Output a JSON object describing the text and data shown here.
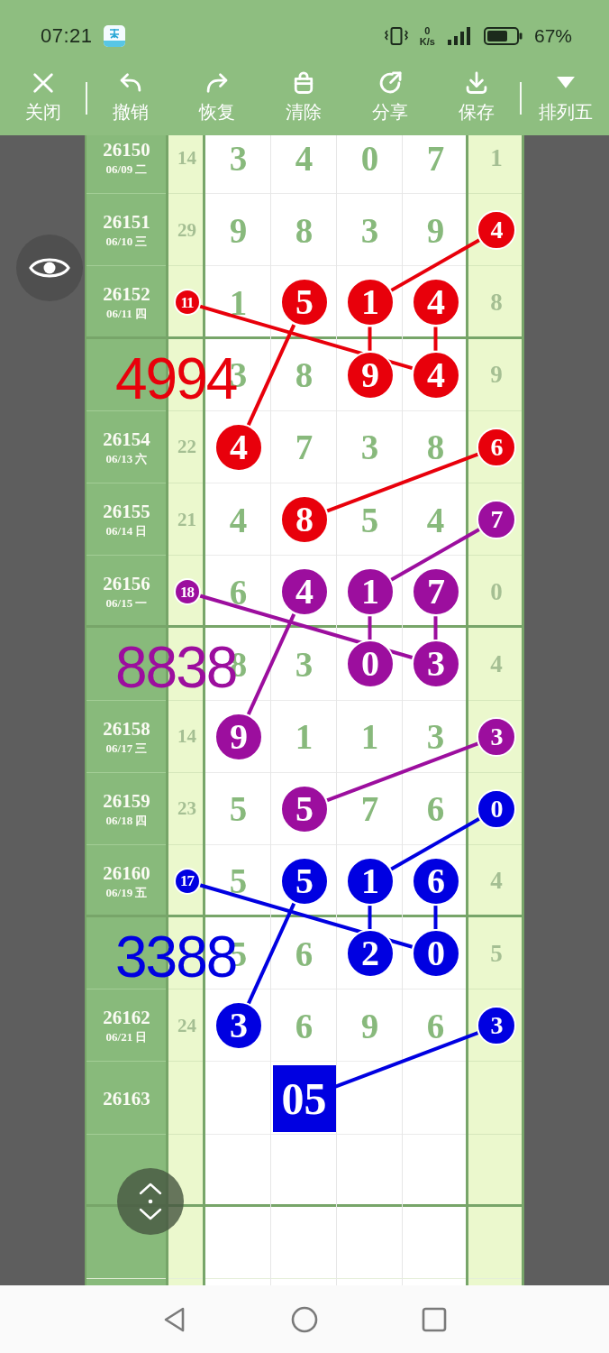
{
  "status_bar": {
    "time": "07:21",
    "net_speed": {
      "value": "0",
      "unit": "K/s"
    },
    "battery": "67%"
  },
  "toolbar": {
    "left": [
      {
        "kind": "close",
        "label": "关闭"
      }
    ],
    "actions": [
      {
        "kind": "undo",
        "label": "撤销"
      },
      {
        "kind": "redo",
        "label": "恢复"
      },
      {
        "kind": "clear",
        "label": "清除"
      },
      {
        "kind": "share",
        "label": "分享"
      },
      {
        "kind": "save",
        "label": "保存"
      }
    ],
    "right": [
      {
        "kind": "menu",
        "label": "排列五"
      }
    ]
  },
  "grid": {
    "rows": [
      {
        "period": "26150",
        "date": "06/09 二",
        "cells": [
          {
            "value": "14",
            "marked": false
          },
          {
            "value": "3",
            "marked": false
          },
          {
            "value": "4",
            "marked": false
          },
          {
            "value": "0",
            "marked": false
          },
          {
            "value": "7",
            "marked": false
          },
          {
            "value": "1",
            "marked": false
          }
        ]
      },
      {
        "period": "26151",
        "date": "06/10 三",
        "cells": [
          {
            "value": "29",
            "marked": false
          },
          {
            "value": "9",
            "marked": false
          },
          {
            "value": "8",
            "marked": false
          },
          {
            "value": "3",
            "marked": false
          },
          {
            "value": "9",
            "marked": false
          },
          {
            "value": "4",
            "marked": true,
            "kind": "circle",
            "color": "#e8000b"
          }
        ]
      },
      {
        "period": "26152",
        "date": "06/11 四",
        "cells": [
          {
            "value": "11",
            "marked": true,
            "kind": "circle",
            "color": "#e8000b"
          },
          {
            "value": "1",
            "marked": false
          },
          {
            "value": "5",
            "marked": true,
            "kind": "circle",
            "color": "#e8000b"
          },
          {
            "value": "1",
            "marked": true,
            "kind": "circle",
            "color": "#e8000b"
          },
          {
            "value": "4",
            "marked": true,
            "kind": "circle",
            "color": "#e8000b"
          },
          {
            "value": "8",
            "marked": false
          }
        ]
      },
      {
        "note": {
          "text": "4994",
          "color": "#e8000b"
        },
        "cells": [
          {
            "marked": false
          },
          {
            "value": "3",
            "marked": false
          },
          {
            "value": "8",
            "marked": false
          },
          {
            "value": "9",
            "marked": true,
            "kind": "circle",
            "color": "#e8000b"
          },
          {
            "value": "4",
            "marked": true,
            "kind": "circle",
            "color": "#e8000b"
          },
          {
            "value": "9",
            "marked": false
          }
        ]
      },
      {
        "period": "26154",
        "date": "06/13 六",
        "cells": [
          {
            "value": "22",
            "marked": false
          },
          {
            "value": "4",
            "marked": true,
            "kind": "circle",
            "color": "#e8000b"
          },
          {
            "value": "7",
            "marked": false
          },
          {
            "value": "3",
            "marked": false
          },
          {
            "value": "8",
            "marked": false
          },
          {
            "value": "6",
            "marked": true,
            "kind": "circle",
            "color": "#e8000b"
          }
        ]
      },
      {
        "period": "26155",
        "date": "06/14 日",
        "cells": [
          {
            "value": "21",
            "marked": false
          },
          {
            "value": "4",
            "marked": false
          },
          {
            "value": "8",
            "marked": true,
            "kind": "circle",
            "color": "#e8000b"
          },
          {
            "value": "5",
            "marked": false
          },
          {
            "value": "4",
            "marked": false
          },
          {
            "value": "7",
            "marked": true,
            "kind": "circle",
            "color": "#9c0e9e"
          }
        ]
      },
      {
        "period": "26156",
        "date": "06/15 一",
        "cells": [
          {
            "value": "18",
            "marked": true,
            "kind": "circle",
            "color": "#9c0e9e"
          },
          {
            "value": "6",
            "marked": false
          },
          {
            "value": "4",
            "marked": true,
            "kind": "circle",
            "color": "#9c0e9e"
          },
          {
            "value": "1",
            "marked": true,
            "kind": "circle",
            "color": "#9c0e9e"
          },
          {
            "value": "7",
            "marked": true,
            "kind": "circle",
            "color": "#9c0e9e"
          },
          {
            "value": "0",
            "marked": false
          }
        ]
      },
      {
        "note": {
          "text": "8838",
          "color": "#9c0e9e"
        },
        "cells": [
          {
            "marked": false
          },
          {
            "value": "8",
            "marked": false
          },
          {
            "value": "3",
            "marked": false
          },
          {
            "value": "0",
            "marked": true,
            "kind": "circle",
            "color": "#9c0e9e"
          },
          {
            "value": "3",
            "marked": true,
            "kind": "circle",
            "color": "#9c0e9e"
          },
          {
            "value": "4",
            "marked": false
          }
        ]
      },
      {
        "period": "26158",
        "date": "06/17 三",
        "cells": [
          {
            "value": "14",
            "marked": false
          },
          {
            "value": "9",
            "marked": true,
            "kind": "circle",
            "color": "#9c0e9e"
          },
          {
            "value": "1",
            "marked": false
          },
          {
            "value": "1",
            "marked": false
          },
          {
            "value": "3",
            "marked": false
          },
          {
            "value": "3",
            "marked": true,
            "kind": "circle",
            "color": "#9c0e9e"
          }
        ]
      },
      {
        "period": "26159",
        "date": "06/18 四",
        "cells": [
          {
            "value": "23",
            "marked": false
          },
          {
            "value": "5",
            "marked": false
          },
          {
            "value": "5",
            "marked": true,
            "kind": "circle",
            "color": "#9c0e9e"
          },
          {
            "value": "7",
            "marked": false
          },
          {
            "value": "6",
            "marked": false
          },
          {
            "value": "0",
            "marked": true,
            "kind": "circle",
            "color": "#0000e1"
          }
        ]
      },
      {
        "period": "26160",
        "date": "06/19 五",
        "cells": [
          {
            "value": "17",
            "marked": true,
            "kind": "circle",
            "color": "#0000e1"
          },
          {
            "value": "5",
            "marked": false
          },
          {
            "value": "5",
            "marked": true,
            "kind": "circle",
            "color": "#0000e1"
          },
          {
            "value": "1",
            "marked": true,
            "kind": "circle",
            "color": "#0000e1"
          },
          {
            "value": "6",
            "marked": true,
            "kind": "circle",
            "color": "#0000e1"
          },
          {
            "value": "4",
            "marked": false
          }
        ]
      },
      {
        "note": {
          "text": "3388",
          "color": "#0000e1"
        },
        "cells": [
          {
            "marked": false
          },
          {
            "value": "5",
            "marked": false
          },
          {
            "value": "6",
            "marked": false
          },
          {
            "value": "2",
            "marked": true,
            "kind": "circle",
            "color": "#0000e1"
          },
          {
            "value": "0",
            "marked": true,
            "kind": "circle",
            "color": "#0000e1"
          },
          {
            "value": "5",
            "marked": false
          }
        ]
      },
      {
        "period": "26162",
        "date": "06/21 日",
        "cells": [
          {
            "value": "24",
            "marked": false
          },
          {
            "value": "3",
            "marked": true,
            "kind": "circle",
            "color": "#0000e1"
          },
          {
            "value": "6",
            "marked": false
          },
          {
            "value": "9",
            "marked": false
          },
          {
            "value": "6",
            "marked": false
          },
          {
            "value": "3",
            "marked": true,
            "kind": "circle",
            "color": "#0000e1"
          }
        ]
      },
      {
        "period": "26163",
        "cells": [
          {
            "marked": false
          },
          {
            "marked": false
          },
          {
            "value": "05",
            "marked": true,
            "kind": "square",
            "color": "#0000e1"
          },
          {
            "marked": false
          },
          {
            "marked": false
          },
          {
            "marked": false
          }
        ]
      }
    ]
  },
  "patterns": [
    {
      "kind": "five_point",
      "color": "#e8000b"
    },
    {
      "kind": "five_point",
      "color": "#9c0e9e"
    },
    {
      "kind": "five_point",
      "color": "#0000e1"
    }
  ]
}
